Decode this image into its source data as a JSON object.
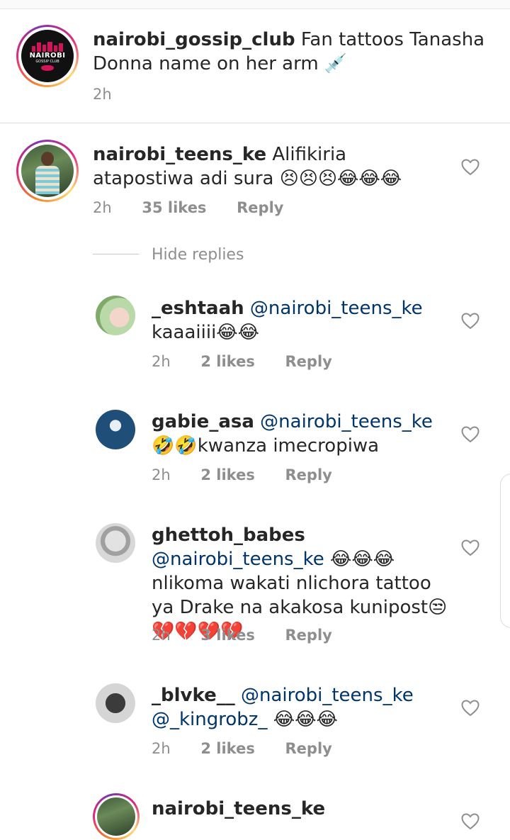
{
  "caption": {
    "username": "nairobi_gossip_club",
    "text": "Fan tattoos Tanasha Donna name on her arm 💉",
    "time": "2h",
    "avatar_logo_top": "NAIROBI",
    "avatar_logo_bottom": "GOSSIP CLUB"
  },
  "comments": [
    {
      "username": "nairobi_teens_ke",
      "text": "Alifikiria atapostiwa adi sura 😣😣😣😂😂😂",
      "time": "2h",
      "likes": "35 likes",
      "reply": "Reply"
    }
  ],
  "hide_replies": "Hide replies",
  "replies": [
    {
      "username": "_eshtaah",
      "mention": "@nairobi_teens_ke",
      "text": "kaaaiiii😂😂",
      "time": "2h",
      "likes": "2 likes",
      "reply": "Reply"
    },
    {
      "username": "gabie_asa",
      "mention": "@nairobi_teens_ke",
      "text": "🤣🤣kwanza imecropiwa",
      "time": "2h",
      "likes": "2 likes",
      "reply": "Reply"
    },
    {
      "username": "ghettoh_babes",
      "mention": "@nairobi_teens_ke",
      "text": "😂😂😂nlikoma wakati nlichora tattoo ya Drake na akakosa kunipost😒💔💔💔💔",
      "time": "2h",
      "likes": "3 likes",
      "reply": "Reply"
    },
    {
      "username": "_blvke__",
      "mention": "@nairobi_teens_ke @_kingrobz_",
      "text": "😂😂😂",
      "time": "2h",
      "likes": "2 likes",
      "reply": "Reply"
    },
    {
      "username": "nairobi_teens_ke",
      "mention": "",
      "text": "",
      "time": "",
      "likes": "",
      "reply": ""
    }
  ],
  "colors": {
    "mention": "#003569",
    "muted": "#8e8e8e",
    "text": "#262626"
  }
}
